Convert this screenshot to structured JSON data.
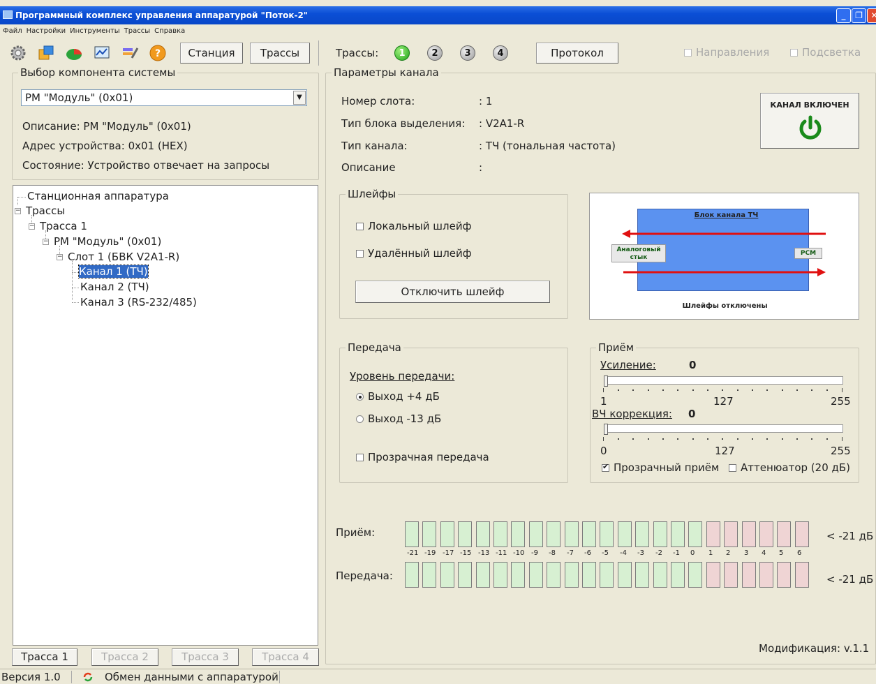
{
  "window": {
    "title": "Программный комплекс управления аппаратурой \"Поток-2\""
  },
  "menu": [
    "Файл",
    "Настройки",
    "Инструменты",
    "Трассы",
    "Справка"
  ],
  "toolbar": {
    "icons": [
      "settings-gear-icon",
      "devices-icon",
      "pie-chart-icon",
      "monitor-graph-icon",
      "tools-icon",
      "help-icon"
    ],
    "station_label": "Станция",
    "tracks_button_label": "Трассы",
    "tracks_label": "Трассы:",
    "track_numbers": [
      "1",
      "2",
      "3",
      "4"
    ],
    "protocol_label": "Протокол",
    "directions_label": "Направления",
    "highlight_label": "Подсветка"
  },
  "component": {
    "group_label": "Выбор компонента системы",
    "selected": "РМ \"Модуль\" (0x01)",
    "description_label": "Описание:",
    "description_value": "РМ \"Модуль\" (0x01)",
    "address_label": "Адрес устройства:",
    "address_value": "0x01 (HEX)",
    "state_label": "Состояние:",
    "state_value": "Устройство отвечает на запросы"
  },
  "tree": {
    "station": "Станционная аппаратура",
    "tracks": "Трассы",
    "track1": "Трасса 1",
    "rm": "РМ \"Модуль\" (0x01)",
    "slot": "Слот 1 (БВК V2A1-R)",
    "ch1": "Канал 1 (ТЧ)",
    "ch2": "Канал 2 (ТЧ)",
    "ch3": "Канал 3 (RS-232/485)"
  },
  "bottom_tabs": [
    "Трасса 1",
    "Трасса 2",
    "Трасса 3",
    "Трасса 4"
  ],
  "channel": {
    "group_label": "Параметры канала",
    "slot_label": "Номер слота:",
    "slot_value": ": 1",
    "block_label": "Тип блока выделения:",
    "block_value": ": V2A1-R",
    "type_label": "Тип канала:",
    "type_value": ": ТЧ (тональная частота)",
    "desc_label": "Описание",
    "desc_value": ":",
    "power_label": "КАНАЛ ВКЛЮЧЕН"
  },
  "loops": {
    "group_label": "Шлейфы",
    "local_label": "Локальный шлейф",
    "remote_label": "Удалённый шлейф",
    "disable_button": "Отключить шлейф"
  },
  "diagram": {
    "block_title": "Блок канала ТЧ",
    "analog_label": "Аналоговый стык",
    "pcm_label": "PCM",
    "status": "Шлейфы отключены"
  },
  "transmit": {
    "group_label": "Передача",
    "level_label": "Уровень передачи:",
    "option1": "Выход +4 дБ",
    "option2": "Выход -13 дБ",
    "transparent_label": "Прозрачная передача"
  },
  "receive": {
    "group_label": "Приём",
    "gain_label": "Усиление:",
    "gain_value": "0",
    "gain_min": "1",
    "gain_mid": "127",
    "gain_max": "255",
    "hf_label": "ВЧ коррекция:",
    "hf_value": "0",
    "hf_min": "0",
    "hf_mid": "127",
    "hf_max": "255",
    "transparent_label": "Прозрачный приём",
    "attenuator_label": "Аттенюатор (20 дБ)"
  },
  "meters": {
    "rx_label": "Приём:",
    "tx_label": "Передача:",
    "rx_value": "< -21 дБ",
    "tx_value": "< -21 дБ",
    "scale": [
      "-21",
      "-19",
      "-17",
      "-15",
      "-13",
      "-11",
      "-10",
      "-9",
      "-8",
      "-7",
      "-6",
      "-5",
      "-4",
      "-3",
      "-2",
      "-1",
      "0",
      "1",
      "2",
      "3",
      "4",
      "5",
      "6"
    ],
    "green_count": 17,
    "colors": {
      "green": "#d7f0d2",
      "red": "#efd4d4"
    }
  },
  "modification": "Модификация:  v.1.1",
  "status": {
    "version": "Версия 1.0",
    "exchange": "Обмен данными с аппаратурой"
  }
}
